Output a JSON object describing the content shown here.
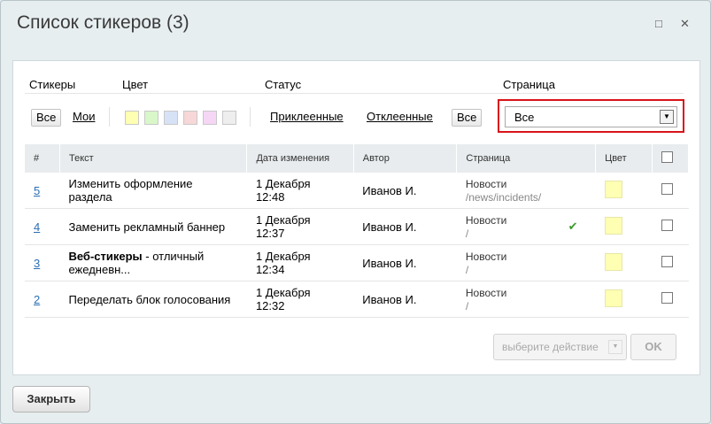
{
  "dialog": {
    "title": "Список стикеров (3)",
    "maximize_icon": "□",
    "close_icon": "✕"
  },
  "filters": {
    "labels": {
      "stickers": "Стикеры",
      "color": "Цвет",
      "status": "Статус",
      "page": "Страница"
    },
    "stickers_all": "Все",
    "stickers_mine": "Мои",
    "colors": [
      "#ffffb3",
      "#d9f7c9",
      "#d7e2f7",
      "#f7d7d7",
      "#f5d7f5",
      "#eeeeee"
    ],
    "status_attached": "Приклеенные",
    "status_detached": "Отклеенные",
    "status_all": "Все",
    "page_select": "Все"
  },
  "table": {
    "headers": [
      "#",
      "Текст",
      "Дата изменения",
      "Автор",
      "Страница",
      "Цвет"
    ],
    "rows": [
      {
        "num": "5",
        "text_bold": "",
        "text": "Изменить оформление раздела",
        "date": "1 Декабря",
        "time": "12:48",
        "author": "Иванов И.",
        "page_title": "Новости",
        "page_url": "/news/incidents/"
      },
      {
        "num": "4",
        "text_bold": "",
        "text": "Заменить рекламный баннер",
        "date": "1 Декабря",
        "time": "12:37",
        "author": "Иванов И.",
        "page_title": "Новости",
        "page_url": "/"
      },
      {
        "num": "3",
        "text_bold": "Веб-стикеры",
        "text": " - отличный ежедневн...",
        "date": "1 Декабря",
        "time": "12:34",
        "author": "Иванов И.",
        "page_title": "Новости",
        "page_url": "/"
      },
      {
        "num": "2",
        "text_bold": "",
        "text": "Переделать блок голосования",
        "date": "1 Декабря",
        "time": "12:32",
        "author": "Иванов И.",
        "page_title": "Новости",
        "page_url": "/"
      }
    ]
  },
  "footer": {
    "action_select": "выберите действие",
    "ok": "OK",
    "close": "Закрыть"
  }
}
